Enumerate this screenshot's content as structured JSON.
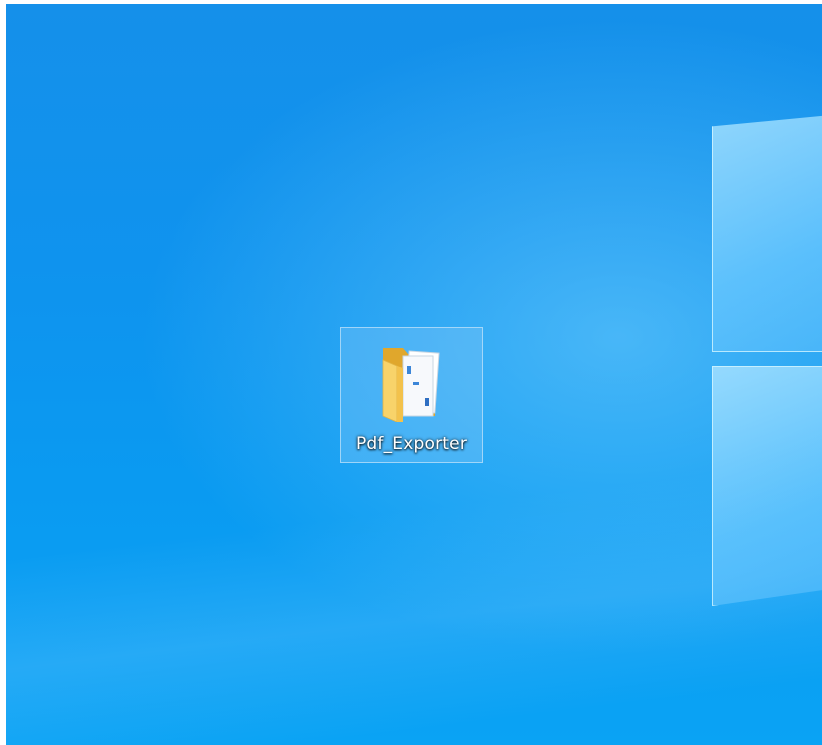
{
  "desktop": {
    "wallpaper": "windows-10-hero",
    "icons": [
      {
        "label": "Pdf_Exporter",
        "icon": "folder-icon",
        "selected": true
      }
    ]
  },
  "colors": {
    "wallpaper_blue": "#0f93ee",
    "folder_yellow": "#f5c84a",
    "selection_border": "#bee1fa"
  }
}
